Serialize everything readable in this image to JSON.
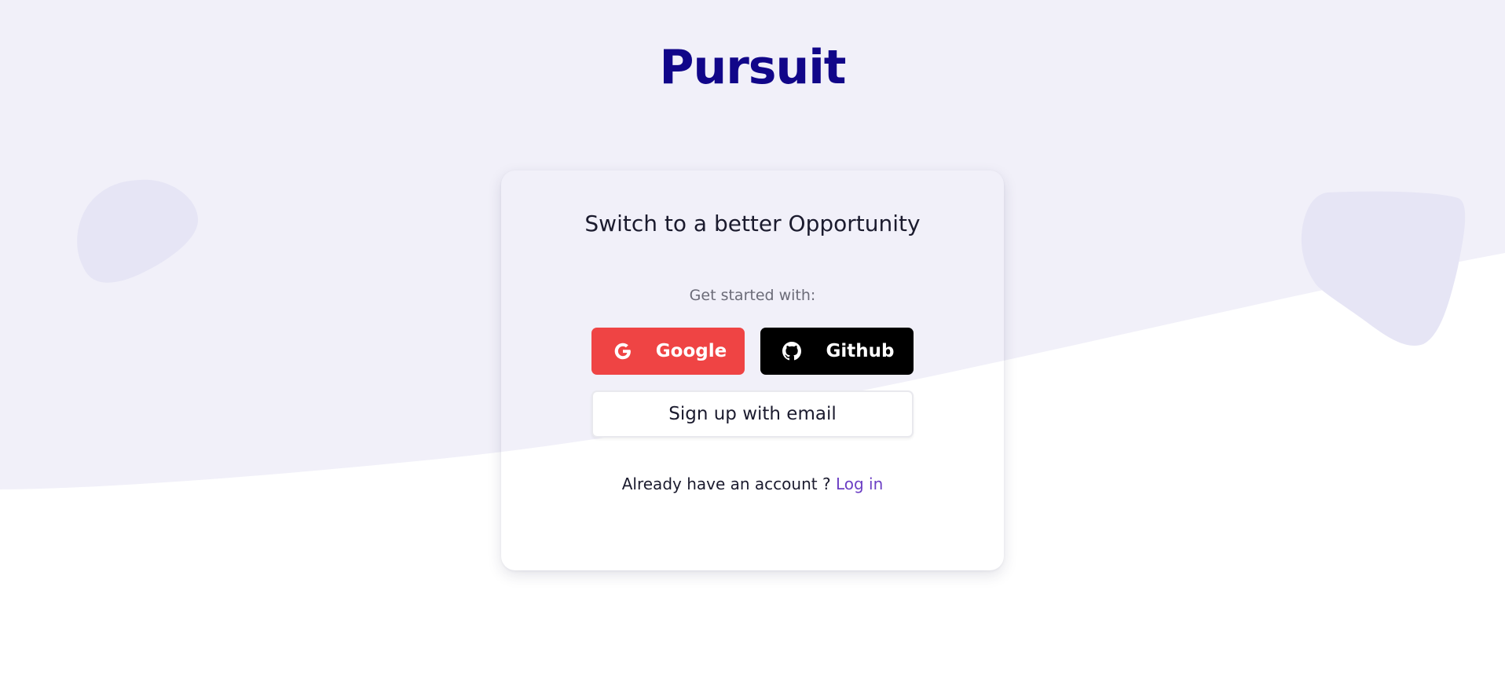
{
  "brand": {
    "name": "Pursuit",
    "color": "#110689"
  },
  "colors": {
    "background_tint": "#f1f0f9",
    "blob": "#e6e5f5",
    "google_button": "#ef4444",
    "github_button": "#000000",
    "link": "#6c3fc4"
  },
  "card": {
    "title": "Switch to a better Opportunity",
    "subtitle": "Get started with:",
    "google_button": {
      "label": "Google",
      "icon": "google-icon"
    },
    "github_button": {
      "label": "Github",
      "icon": "github-icon"
    },
    "email_button": {
      "label": "Sign up with email"
    },
    "login_prompt": "Already have an account ?",
    "login_link": "Log in"
  }
}
